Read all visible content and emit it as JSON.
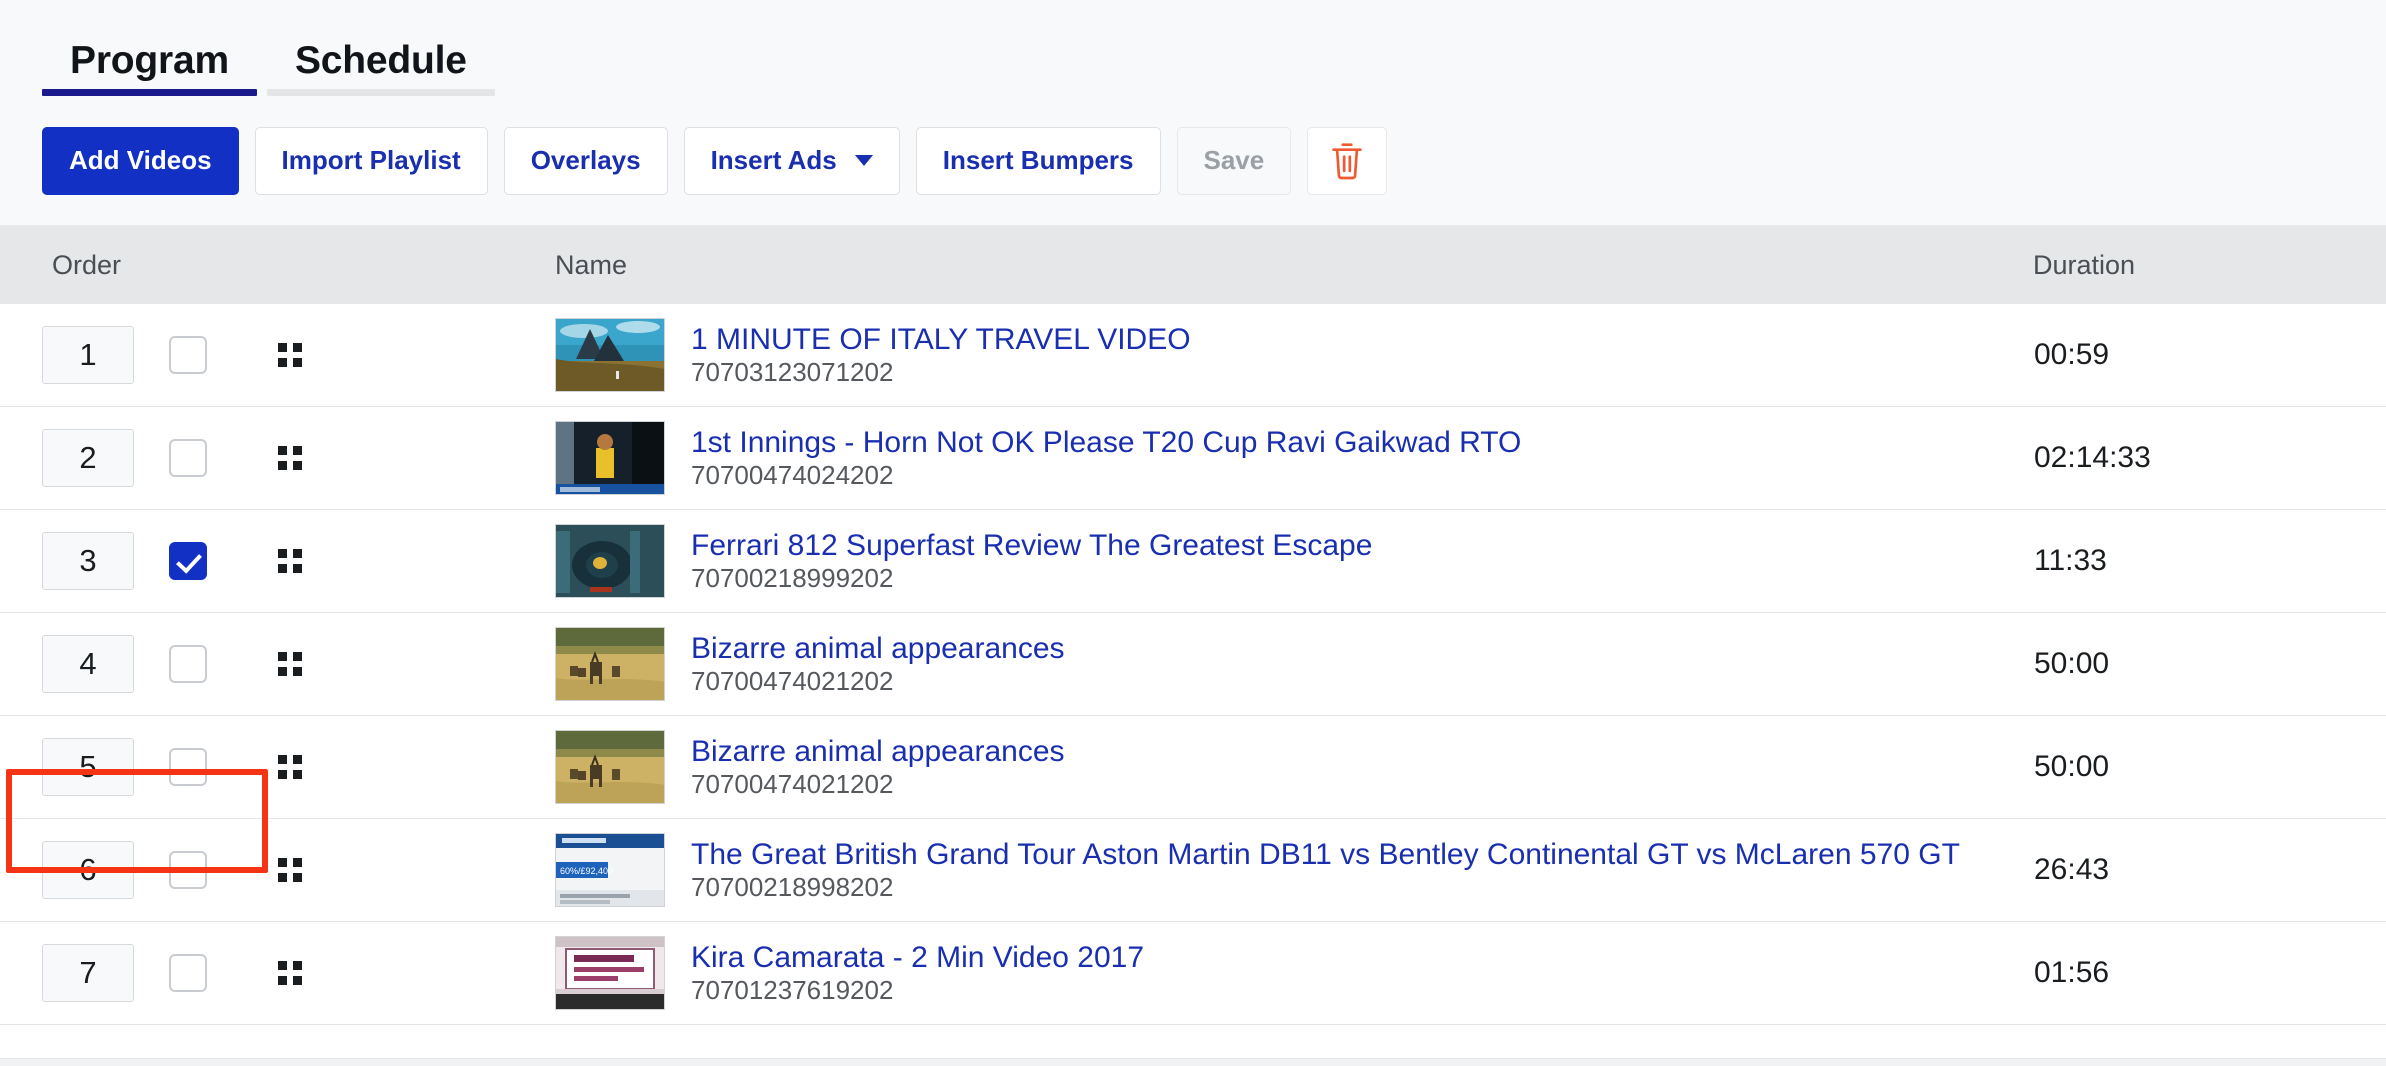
{
  "tabs": [
    {
      "label": "Program",
      "active": true
    },
    {
      "label": "Schedule",
      "active": false
    }
  ],
  "toolbar": {
    "add_videos_label": "Add Videos",
    "import_playlist_label": "Import Playlist",
    "overlays_label": "Overlays",
    "insert_ads_label": "Insert Ads",
    "insert_bumpers_label": "Insert Bumpers",
    "save_label": "Save",
    "delete_label": ""
  },
  "colors": {
    "primary": "#1230c4",
    "link": "#1a2fb0",
    "tab_underline_active": "#1a1a8c",
    "tab_underline_inactive": "#e3e5e6",
    "header_bg": "#e5e7e8",
    "delete_icon": "#f05a33",
    "highlight_box": "#f53415",
    "disabled_text": "#9aa0a6"
  },
  "table": {
    "columns": [
      "Order",
      "Name",
      "Duration"
    ],
    "rows": [
      {
        "order": "1",
        "checked": false,
        "title": "1 MINUTE OF ITALY TRAVEL VIDEO",
        "video_id": "70703123071202",
        "duration": "00:59",
        "thumb": "italy-mountain"
      },
      {
        "order": "2",
        "checked": false,
        "title": "1st Innings - Horn Not OK Please T20 Cup Ravi Gaikwad RTO",
        "video_id": "70700474024202",
        "duration": "02:14:33",
        "thumb": "cricket-player"
      },
      {
        "order": "3",
        "checked": true,
        "title": "Ferrari 812 Superfast Review The Greatest Escape",
        "video_id": "70700218999202",
        "duration": "11:33",
        "thumb": "ferrari-car"
      },
      {
        "order": "4",
        "checked": false,
        "title": "Bizarre animal appearances",
        "video_id": "70700474021202",
        "duration": "50:00",
        "thumb": "deer-field"
      },
      {
        "order": "5",
        "checked": false,
        "title": "Bizarre animal appearances",
        "video_id": "70700474021202",
        "duration": "50:00",
        "thumb": "deer-field"
      },
      {
        "order": "6",
        "checked": false,
        "title": "The Great British Grand Tour Aston Martin DB11 vs Bentley Continental GT vs McLaren 570 GT",
        "video_id": "70700218998202",
        "duration": "26:43",
        "thumb": "grand-tour-chart"
      },
      {
        "order": "7",
        "checked": false,
        "title": "Kira Camarata - 2 Min Video 2017",
        "video_id": "70701237619202",
        "duration": "01:56",
        "thumb": "kira-sign"
      }
    ]
  }
}
